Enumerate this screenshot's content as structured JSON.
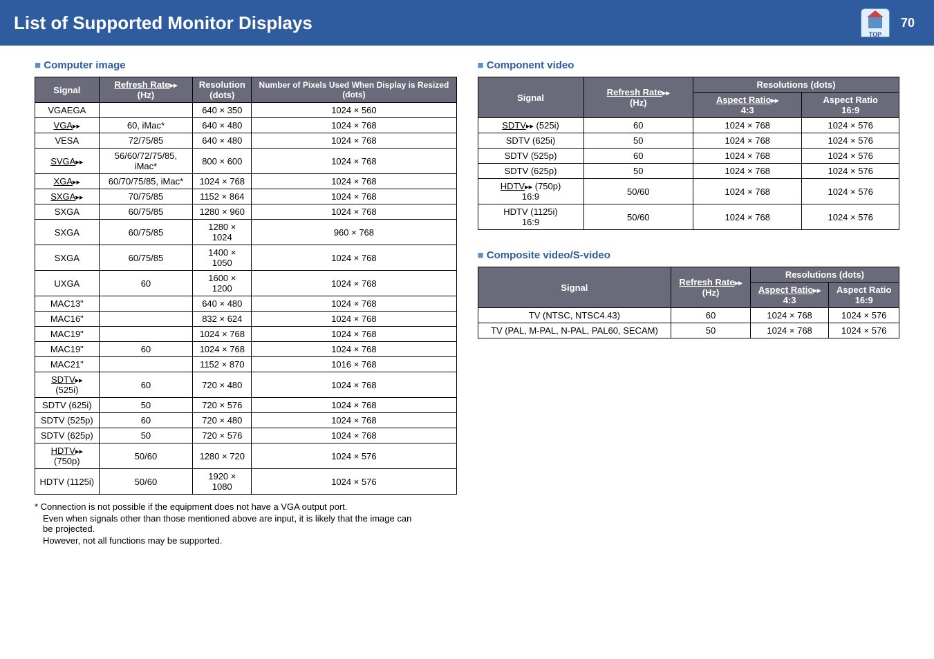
{
  "page": {
    "title": "List of Supported Monitor Displays",
    "number": "70",
    "top_label": "TOP"
  },
  "sections": {
    "computer": {
      "title": "Computer image"
    },
    "component": {
      "title": "Component video"
    },
    "composite": {
      "title": "Composite video/S-video"
    }
  },
  "headers": {
    "signal": "Signal",
    "refresh": "Refresh Rate",
    "refresh_unit": "(Hz)",
    "resolution": "Resolution",
    "resolution_unit": "(dots)",
    "pixels": "Number of Pixels Used When Display is Resized (dots)",
    "resolutions": "Resolutions (dots)",
    "ar43": "Aspect Ratio",
    "ar43_sub": "4:3",
    "ar169": "Aspect Ratio",
    "ar169_sub": "16:9"
  },
  "computer_rows": [
    {
      "s": "VGAEGA",
      "r": "",
      "res": "640 × 350",
      "p": "1024 × 560",
      "link": false
    },
    {
      "s": "VGA",
      "r": "60, iMac*",
      "res": "640 × 480",
      "p": "1024 × 768",
      "link": true
    },
    {
      "s": "VESA",
      "r": "72/75/85",
      "res": "640 × 480",
      "p": "1024 × 768",
      "link": false
    },
    {
      "s": "SVGA",
      "r": "56/60/72/75/85, iMac*",
      "res": "800 × 600",
      "p": "1024 × 768",
      "link": true
    },
    {
      "s": "XGA",
      "r": "60/70/75/85, iMac*",
      "res": "1024 × 768",
      "p": "1024 × 768",
      "link": true
    },
    {
      "s": "SXGA",
      "r": "70/75/85",
      "res": "1152 × 864",
      "p": "1024 × 768",
      "link": true
    },
    {
      "s": "SXGA",
      "r": "60/75/85",
      "res": "1280 × 960",
      "p": "1024 × 768",
      "link": false
    },
    {
      "s": "SXGA",
      "r": "60/75/85",
      "res": "1280 × 1024",
      "p": "960 × 768",
      "link": false
    },
    {
      "s": "SXGA",
      "r": "60/75/85",
      "res": "1400 × 1050",
      "p": "1024 × 768",
      "link": false
    },
    {
      "s": "UXGA",
      "r": "60",
      "res": "1600 × 1200",
      "p": "1024 × 768",
      "link": false
    },
    {
      "s": "MAC13\"",
      "r": "",
      "res": "640 × 480",
      "p": "1024 × 768",
      "link": false
    },
    {
      "s": "MAC16\"",
      "r": "",
      "res": "832 × 624",
      "p": "1024 × 768",
      "link": false
    },
    {
      "s": "MAC19\"",
      "r": "",
      "res": "1024 × 768",
      "p": "1024 × 768",
      "link": false
    },
    {
      "s": "MAC19\"",
      "r": "60",
      "res": "1024 × 768",
      "p": "1024 × 768",
      "link": false
    },
    {
      "s": "MAC21\"",
      "r": "",
      "res": "1152 × 870",
      "p": "1016 × 768",
      "link": false
    },
    {
      "s": "SDTV (525i)",
      "r": "60",
      "res": "720 × 480",
      "p": "1024 × 768",
      "link": true,
      "partial": "SDTV"
    },
    {
      "s": "SDTV (625i)",
      "r": "50",
      "res": "720 × 576",
      "p": "1024 × 768",
      "link": false
    },
    {
      "s": "SDTV (525p)",
      "r": "60",
      "res": "720 × 480",
      "p": "1024 × 768",
      "link": false
    },
    {
      "s": "SDTV (625p)",
      "r": "50",
      "res": "720 × 576",
      "p": "1024 × 768",
      "link": false
    },
    {
      "s": "HDTV (750p)",
      "r": "50/60",
      "res": "1280 × 720",
      "p": "1024 × 576",
      "link": true,
      "partial": "HDTV",
      "rest": "(750p)",
      "two": true
    },
    {
      "s": "HDTV (1125i)",
      "r": "50/60",
      "res": "1920 × 1080",
      "p": "1024 × 576",
      "link": false
    }
  ],
  "component_rows": [
    {
      "s": "SDTV (525i)",
      "r": "60",
      "a": "1024 × 768",
      "b": "1024 × 576",
      "link": true,
      "partial": "SDTV",
      "rest": " (525i)"
    },
    {
      "s": "SDTV (625i)",
      "r": "50",
      "a": "1024 × 768",
      "b": "1024 × 576",
      "link": false
    },
    {
      "s": "SDTV (525p)",
      "r": "60",
      "a": "1024 × 768",
      "b": "1024 × 576",
      "link": false
    },
    {
      "s": "SDTV (625p)",
      "r": "50",
      "a": "1024 × 768",
      "b": "1024 × 576",
      "link": false
    },
    {
      "s": "HDTV (750p) 16:9",
      "r": "50/60",
      "a": "1024 × 768",
      "b": "1024 × 576",
      "link": true,
      "partial": "HDTV",
      "rest": " (750p)",
      "extra": "16:9"
    },
    {
      "s": "HDTV (1125i) 16:9",
      "r": "50/60",
      "a": "1024 × 768",
      "b": "1024 × 576",
      "link": false,
      "two_line": "HDTV (1125i)",
      "extra": "16:9"
    }
  ],
  "composite_rows": [
    {
      "s": "TV (NTSC, NTSC4.43)",
      "r": "60",
      "a": "1024 × 768",
      "b": "1024 × 576"
    },
    {
      "s": "TV (PAL, M-PAL, N-PAL, PAL60, SECAM)",
      "r": "50",
      "a": "1024 × 768",
      "b": "1024 × 576"
    }
  ],
  "footnote": {
    "l1": "* Connection is not possible if the equipment does not have a VGA output port.",
    "l2": "Even when signals other than those mentioned above are input, it is likely that the image can be projected.",
    "l3": "However, not all functions may be supported."
  }
}
